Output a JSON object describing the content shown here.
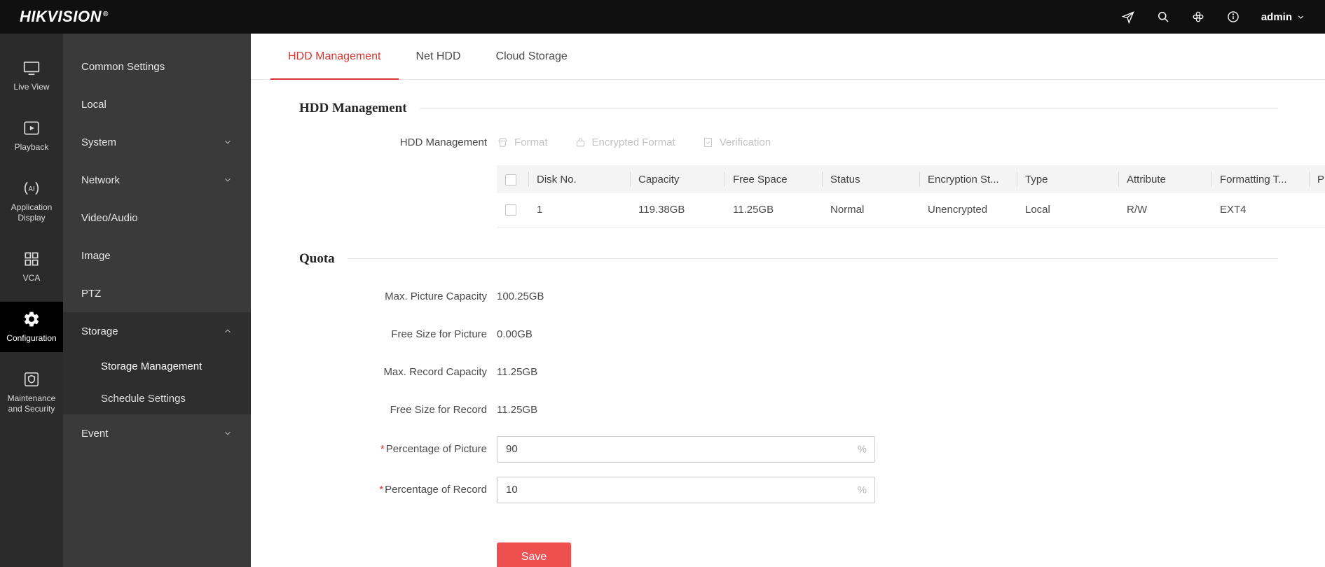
{
  "header": {
    "logo": "HIKVISION",
    "trademark": "®",
    "user": {
      "name": "admin"
    }
  },
  "rail": {
    "items": [
      {
        "label": "Live View"
      },
      {
        "label": "Playback"
      },
      {
        "label": "Application Display"
      },
      {
        "label": "VCA"
      },
      {
        "label": "Configuration"
      },
      {
        "label": "Maintenance and Security"
      }
    ]
  },
  "menu": {
    "header": "Common Settings",
    "items": {
      "local": "Local",
      "system": "System",
      "network": "Network",
      "video_audio": "Video/Audio",
      "image": "Image",
      "ptz": "PTZ",
      "storage": "Storage",
      "storage_management": "Storage Management",
      "schedule_settings": "Schedule Settings",
      "event": "Event"
    }
  },
  "tabs": [
    {
      "label": "HDD Management"
    },
    {
      "label": "Net HDD"
    },
    {
      "label": "Cloud Storage"
    }
  ],
  "hdd": {
    "section_title": "HDD Management",
    "row_label": "HDD Management",
    "toolbar": {
      "format": "Format",
      "encrypted_format": "Encrypted Format",
      "verification": "Verification"
    },
    "table": {
      "headers": [
        "Disk No.",
        "Capacity",
        "Free Space",
        "Status",
        "Encryption St...",
        "Type",
        "Attribute",
        "Formatting T...",
        "P"
      ],
      "rows": [
        {
          "disk_no": "1",
          "capacity": "119.38GB",
          "free_space": "11.25GB",
          "status": "Normal",
          "encryption": "Unencrypted",
          "type": "Local",
          "attribute": "R/W",
          "formatting": "EXT4",
          "p": ""
        }
      ]
    }
  },
  "quota": {
    "section_title": "Quota",
    "stats": [
      {
        "label": "Max. Picture Capacity",
        "value": "100.25GB"
      },
      {
        "label": "Free Size for Picture",
        "value": "0.00GB"
      },
      {
        "label": "Max. Record Capacity",
        "value": "11.25GB"
      },
      {
        "label": "Free Size for Record",
        "value": "11.25GB"
      }
    ],
    "inputs": [
      {
        "label": "Percentage of Picture",
        "required": "*",
        "value": "90",
        "suffix": "%"
      },
      {
        "label": "Percentage of Record",
        "required": "*",
        "value": "10",
        "suffix": "%"
      }
    ],
    "save_label": "Save"
  },
  "colors": {
    "accent": "#d43731",
    "save_button": "#ee4f4f"
  }
}
